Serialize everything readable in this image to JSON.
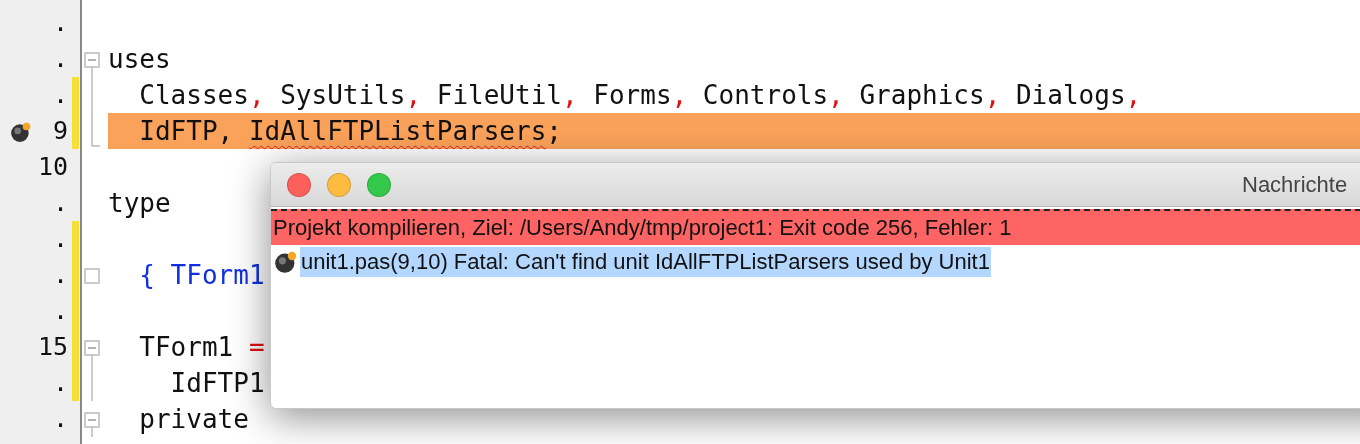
{
  "editor": {
    "lines": [
      {
        "number": ".",
        "changed": false,
        "kind": "plain",
        "bomb": false,
        "highlighted": false
      },
      {
        "number": ".",
        "changed": false,
        "kind": "fold_open",
        "bomb": false,
        "highlighted": false,
        "tokens": [
          {
            "kind": "plain",
            "text": "uses"
          }
        ]
      },
      {
        "number": ".",
        "changed": true,
        "kind": "fold_line",
        "bomb": false,
        "highlighted": false,
        "tokens": [
          {
            "kind": "plain",
            "text": "  Classes"
          },
          {
            "kind": "symbol",
            "text": ","
          },
          {
            "kind": "plain",
            "text": " SysUtils"
          },
          {
            "kind": "symbol",
            "text": ","
          },
          {
            "kind": "plain",
            "text": " FileUtil"
          },
          {
            "kind": "symbol",
            "text": ","
          },
          {
            "kind": "plain",
            "text": " Forms"
          },
          {
            "kind": "symbol",
            "text": ","
          },
          {
            "kind": "plain",
            "text": " Controls"
          },
          {
            "kind": "symbol",
            "text": ","
          },
          {
            "kind": "plain",
            "text": " Graphics"
          },
          {
            "kind": "symbol",
            "text": ","
          },
          {
            "kind": "plain",
            "text": " Dialogs"
          },
          {
            "kind": "symbol",
            "text": ","
          }
        ]
      },
      {
        "number": "9",
        "changed": true,
        "kind": "fold_end",
        "bomb": true,
        "highlighted": true,
        "tokens": [
          {
            "kind": "plain",
            "text": "  IdFTP, "
          },
          {
            "kind": "error",
            "text": "IdAllFTPListParsers"
          },
          {
            "kind": "plain",
            "text": ";"
          }
        ]
      },
      {
        "number": "10",
        "changed": false,
        "kind": "plain",
        "bomb": false,
        "highlighted": false
      },
      {
        "number": ".",
        "changed": false,
        "kind": "plain",
        "bomb": false,
        "highlighted": false,
        "tokens": [
          {
            "kind": "plain",
            "text": "type"
          }
        ]
      },
      {
        "number": ".",
        "changed": true,
        "kind": "plain",
        "bomb": false,
        "highlighted": false
      },
      {
        "number": ".",
        "changed": true,
        "kind": "fold_leaf",
        "bomb": false,
        "highlighted": false,
        "tokens": [
          {
            "kind": "comment",
            "text": "  { TForm1"
          }
        ]
      },
      {
        "number": ".",
        "changed": true,
        "kind": "plain",
        "bomb": false,
        "highlighted": false
      },
      {
        "number": "15",
        "changed": true,
        "kind": "fold_open",
        "bomb": false,
        "highlighted": false,
        "tokens": [
          {
            "kind": "plain",
            "text": "  TForm1 "
          },
          {
            "kind": "symbol",
            "text": "="
          }
        ]
      },
      {
        "number": ".",
        "changed": true,
        "kind": "fold_line",
        "bomb": false,
        "highlighted": false,
        "tokens": [
          {
            "kind": "plain",
            "text": "    IdFTP1"
          }
        ]
      },
      {
        "number": ".",
        "changed": false,
        "kind": "fold_open",
        "bomb": false,
        "highlighted": false,
        "tokens": [
          {
            "kind": "plain",
            "text": "  private"
          }
        ]
      }
    ]
  },
  "messages_window": {
    "title": "Nachrichte",
    "rows": [
      {
        "kind": "error_header",
        "text": "Projekt kompilieren, Ziel: /Users/Andy/tmp/project1: Exit code 256, Fehler: 1",
        "selected": false
      },
      {
        "kind": "fatal",
        "text": "unit1.pas(9,10) Fatal: Can't find unit IdAllFTPListParsers used by Unit1",
        "selected": true
      }
    ]
  }
}
